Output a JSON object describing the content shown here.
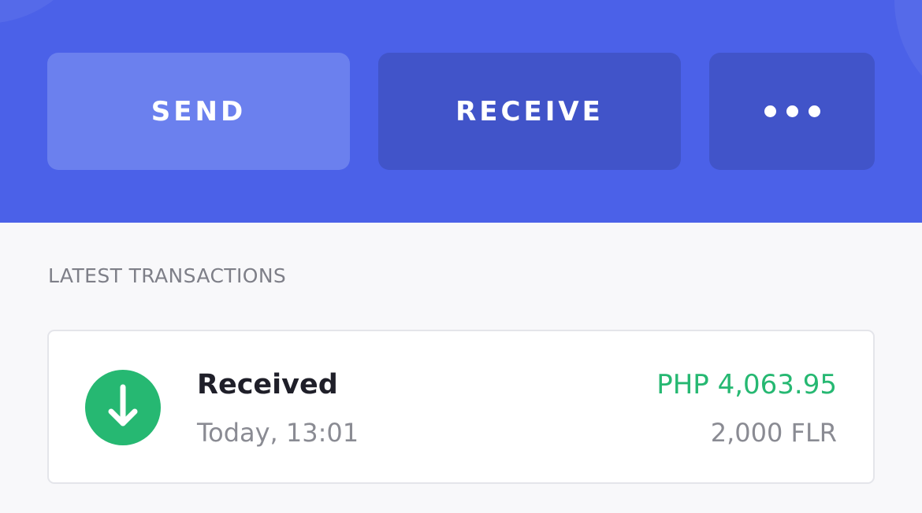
{
  "actions": {
    "send_label": "SEND",
    "receive_label": "RECEIVE",
    "more_icon": "more-dots-icon"
  },
  "transactions": {
    "section_title": "LATEST TRANSACTIONS",
    "items": [
      {
        "icon": "arrow-down-icon",
        "type": "Received",
        "time": "Today, 13:01",
        "fiat_amount": "PHP 4,063.95",
        "crypto_amount": "2,000 FLR"
      }
    ]
  },
  "colors": {
    "header_bg": "#4b61e8",
    "send_button_bg": "#6b80ee",
    "secondary_button_bg": "#4154c9",
    "received_green": "#26b872",
    "page_bg": "#f8f8fa"
  }
}
